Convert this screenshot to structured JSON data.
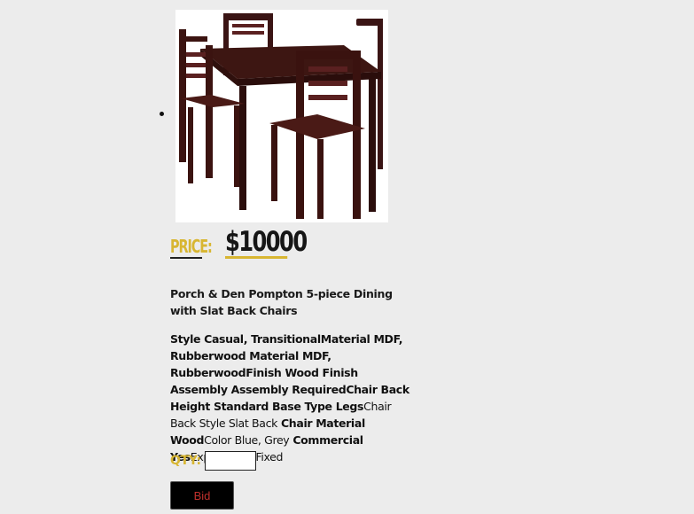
{
  "product": {
    "image_alt": "dining-table-with-four-chairs",
    "price_label": "PRICE:",
    "price_value": "$10000",
    "title": "Porch & Den Pompton 5-piece Dining with Slat Back Chairs",
    "specs": [
      {
        "key": "Style ",
        "value": "Casual, Transitional"
      },
      {
        "key": "Material ",
        "value": "MDF, Rubberwood"
      },
      {
        "key": " Material ",
        "value": "MDF, Rubberwood"
      },
      {
        "key": "Finish ",
        "value": "Wood Finish"
      },
      {
        "key": " Assembly ",
        "value": "Assembly Required"
      },
      {
        "key": "Chair Back Height ",
        "value": "Standard"
      },
      {
        "key": " Base Type ",
        "value": "Legs"
      },
      {
        "key": "Chair Back Style ",
        "value": "Slat Back"
      },
      {
        "key": " Chair Material ",
        "value": "Wood"
      },
      {
        "key": "Color ",
        "value": "Blue, Grey"
      },
      {
        "key": " Commercial ",
        "value": "Yes"
      },
      {
        "key": "Expandable ",
        "value": "Fixed"
      }
    ]
  },
  "qty": {
    "label": "QTY:",
    "value": ""
  },
  "bid": {
    "label": "Bid"
  },
  "colors": {
    "accent": "#d8b632",
    "background": "#ececec",
    "button_bg": "#000000",
    "button_text": "#c0302c"
  }
}
